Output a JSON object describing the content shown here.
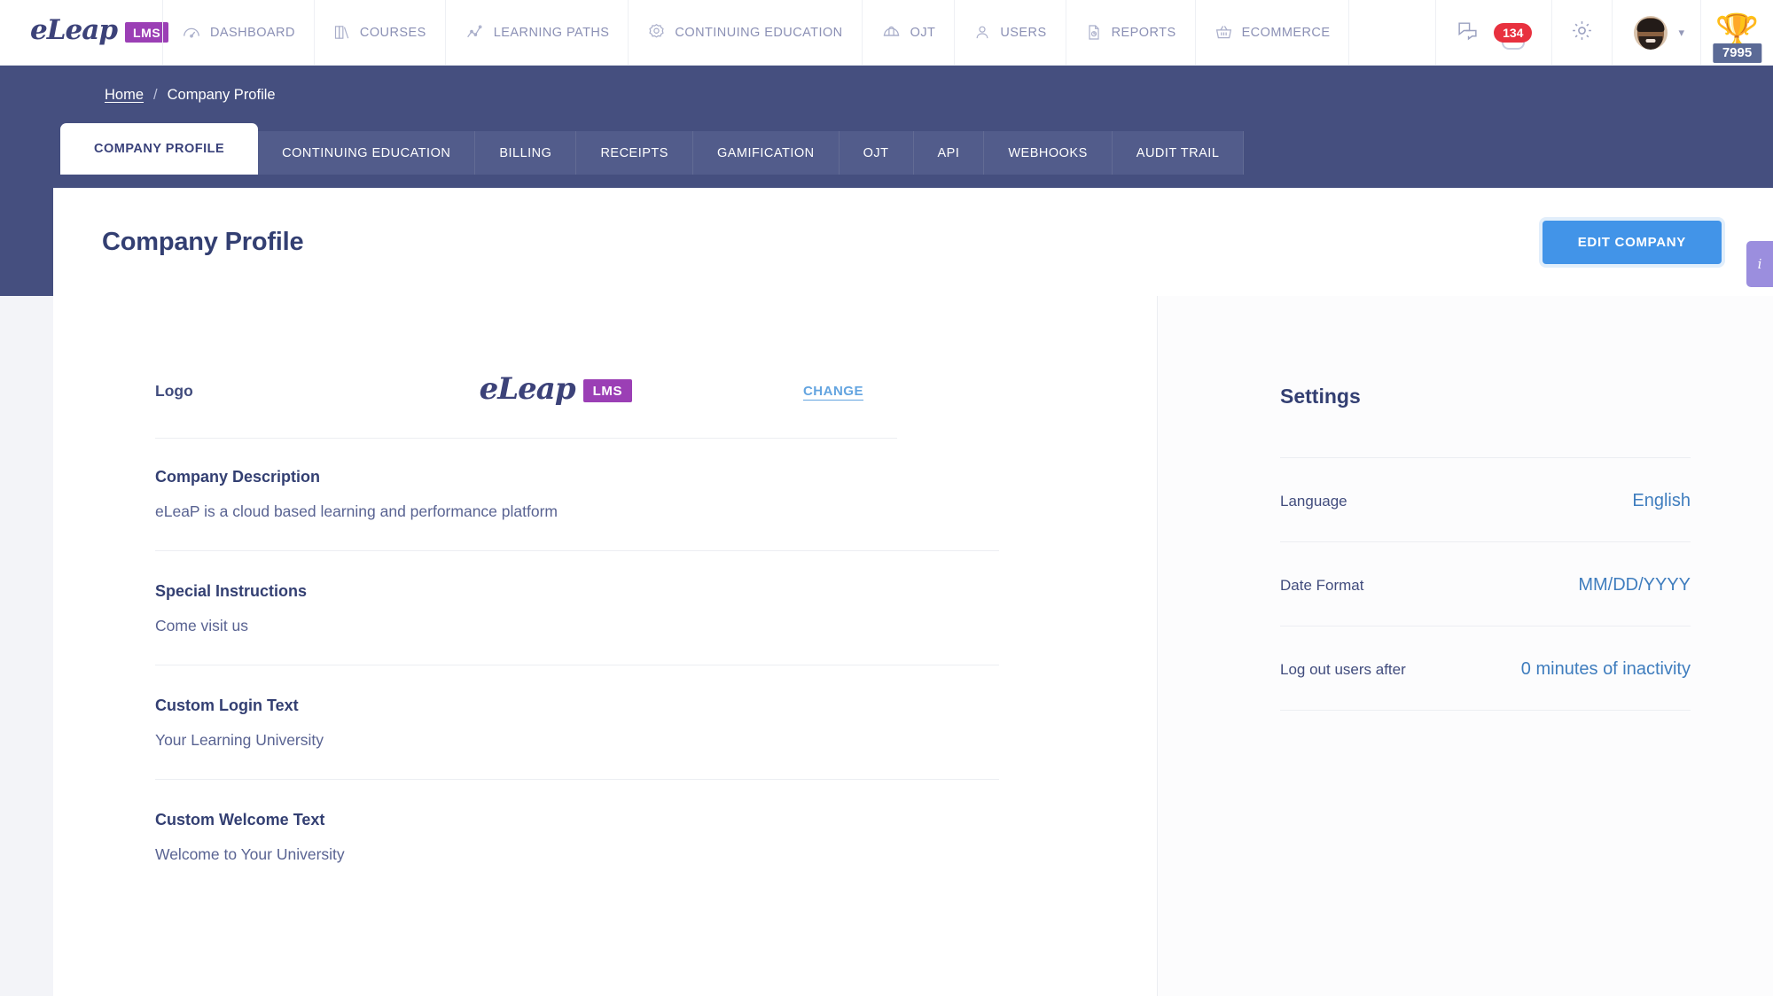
{
  "brand": {
    "word": "eLeap",
    "badge": "LMS"
  },
  "nav": {
    "items": [
      {
        "label": "DASHBOARD",
        "icon": "gauge-icon"
      },
      {
        "label": "COURSES",
        "icon": "books-icon"
      },
      {
        "label": "LEARNING PATHS",
        "icon": "trend-line-icon"
      },
      {
        "label": "CONTINUING EDUCATION",
        "icon": "rosette-icon"
      },
      {
        "label": "OJT",
        "icon": "hardhat-icon"
      },
      {
        "label": "USERS",
        "icon": "user-icon"
      },
      {
        "label": "REPORTS",
        "icon": "report-doc-icon"
      },
      {
        "label": "ECOMMERCE",
        "icon": "basket-icon"
      }
    ]
  },
  "header_right": {
    "chat_icon": "chat-bubbles-icon",
    "notification_count": "134",
    "settings_icon": "gear-icon",
    "avatar_chevron": "▾",
    "trophy_icon": "trophy-icon",
    "trophy_points": "7995"
  },
  "breadcrumb": {
    "home": "Home",
    "separator": "/",
    "current": "Company Profile"
  },
  "tabs": [
    {
      "label": "COMPANY PROFILE",
      "active": true
    },
    {
      "label": "CONTINUING EDUCATION",
      "active": false
    },
    {
      "label": "BILLING",
      "active": false
    },
    {
      "label": "RECEIPTS",
      "active": false
    },
    {
      "label": "GAMIFICATION",
      "active": false
    },
    {
      "label": "OJT",
      "active": false
    },
    {
      "label": "API",
      "active": false
    },
    {
      "label": "WEBHOOKS",
      "active": false
    },
    {
      "label": "AUDIT TRAIL",
      "active": false
    }
  ],
  "page": {
    "title": "Company Profile",
    "edit_button": "EDIT COMPANY",
    "side_tab_glyph": "i"
  },
  "profile": {
    "logo_label": "Logo",
    "change_link": "CHANGE",
    "fields": [
      {
        "label": "Company Description",
        "value": "eLeaP is a cloud based learning and performance platform"
      },
      {
        "label": "Special Instructions",
        "value": "Come visit us"
      },
      {
        "label": "Custom Login Text",
        "value": "Your Learning University"
      },
      {
        "label": "Custom Welcome Text",
        "value": "Welcome to Your University"
      }
    ]
  },
  "settings": {
    "title": "Settings",
    "rows": [
      {
        "label": "Language",
        "value": "English"
      },
      {
        "label": "Date Format",
        "value": "MM/DD/YYYY"
      },
      {
        "label": "Log out users after",
        "value": "0 minutes of inactivity"
      }
    ]
  },
  "colors": {
    "brand_purple": "#9b3fb5",
    "navy": "#454f7f",
    "accent_blue": "#4294e8",
    "badge_red": "#e8313f",
    "link_blue": "#3f7dbe",
    "side_tab_purple": "#9b8ede"
  }
}
